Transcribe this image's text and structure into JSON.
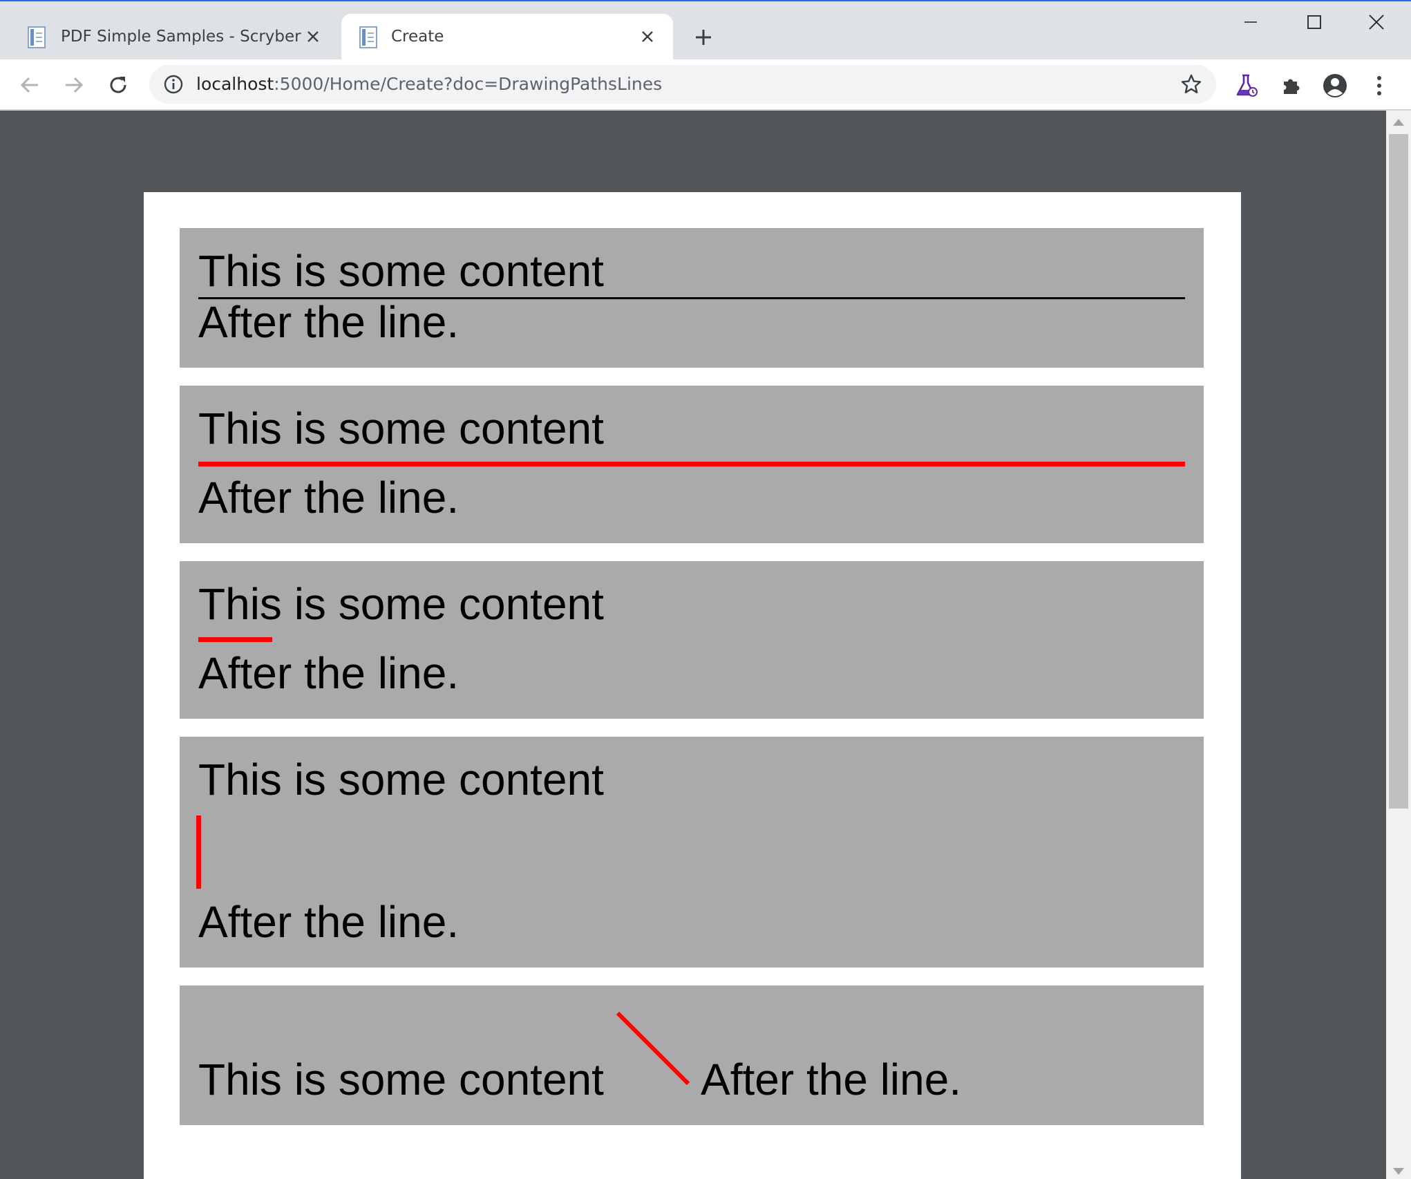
{
  "browser": {
    "tabs": [
      {
        "title": "PDF Simple Samples - Scryber",
        "active": false
      },
      {
        "title": "Create",
        "active": true
      }
    ],
    "address": {
      "host": "localhost",
      "rest": ":5000/Home/Create?doc=DrawingPathsLines"
    }
  },
  "document": {
    "blocks": [
      {
        "before": "This is some content",
        "after": "After the line.",
        "line": "full-width thin black horizontal",
        "line_color": "#000000"
      },
      {
        "before": "This is some content",
        "after": "After the line.",
        "line": "full-width thick red horizontal",
        "line_color": "#ff0000"
      },
      {
        "before": "This is some content",
        "after": "After the line.",
        "line": "short red horizontal",
        "line_color": "#ff0000"
      },
      {
        "before": "This is some content",
        "after": "After the line.",
        "line": "red vertical",
        "line_color": "#ff0000"
      },
      {
        "before": "This is some content",
        "after": "After the line.",
        "line": "red diagonal inline",
        "line_color": "#ff0000"
      }
    ],
    "block_background": "#aaaaaa"
  }
}
